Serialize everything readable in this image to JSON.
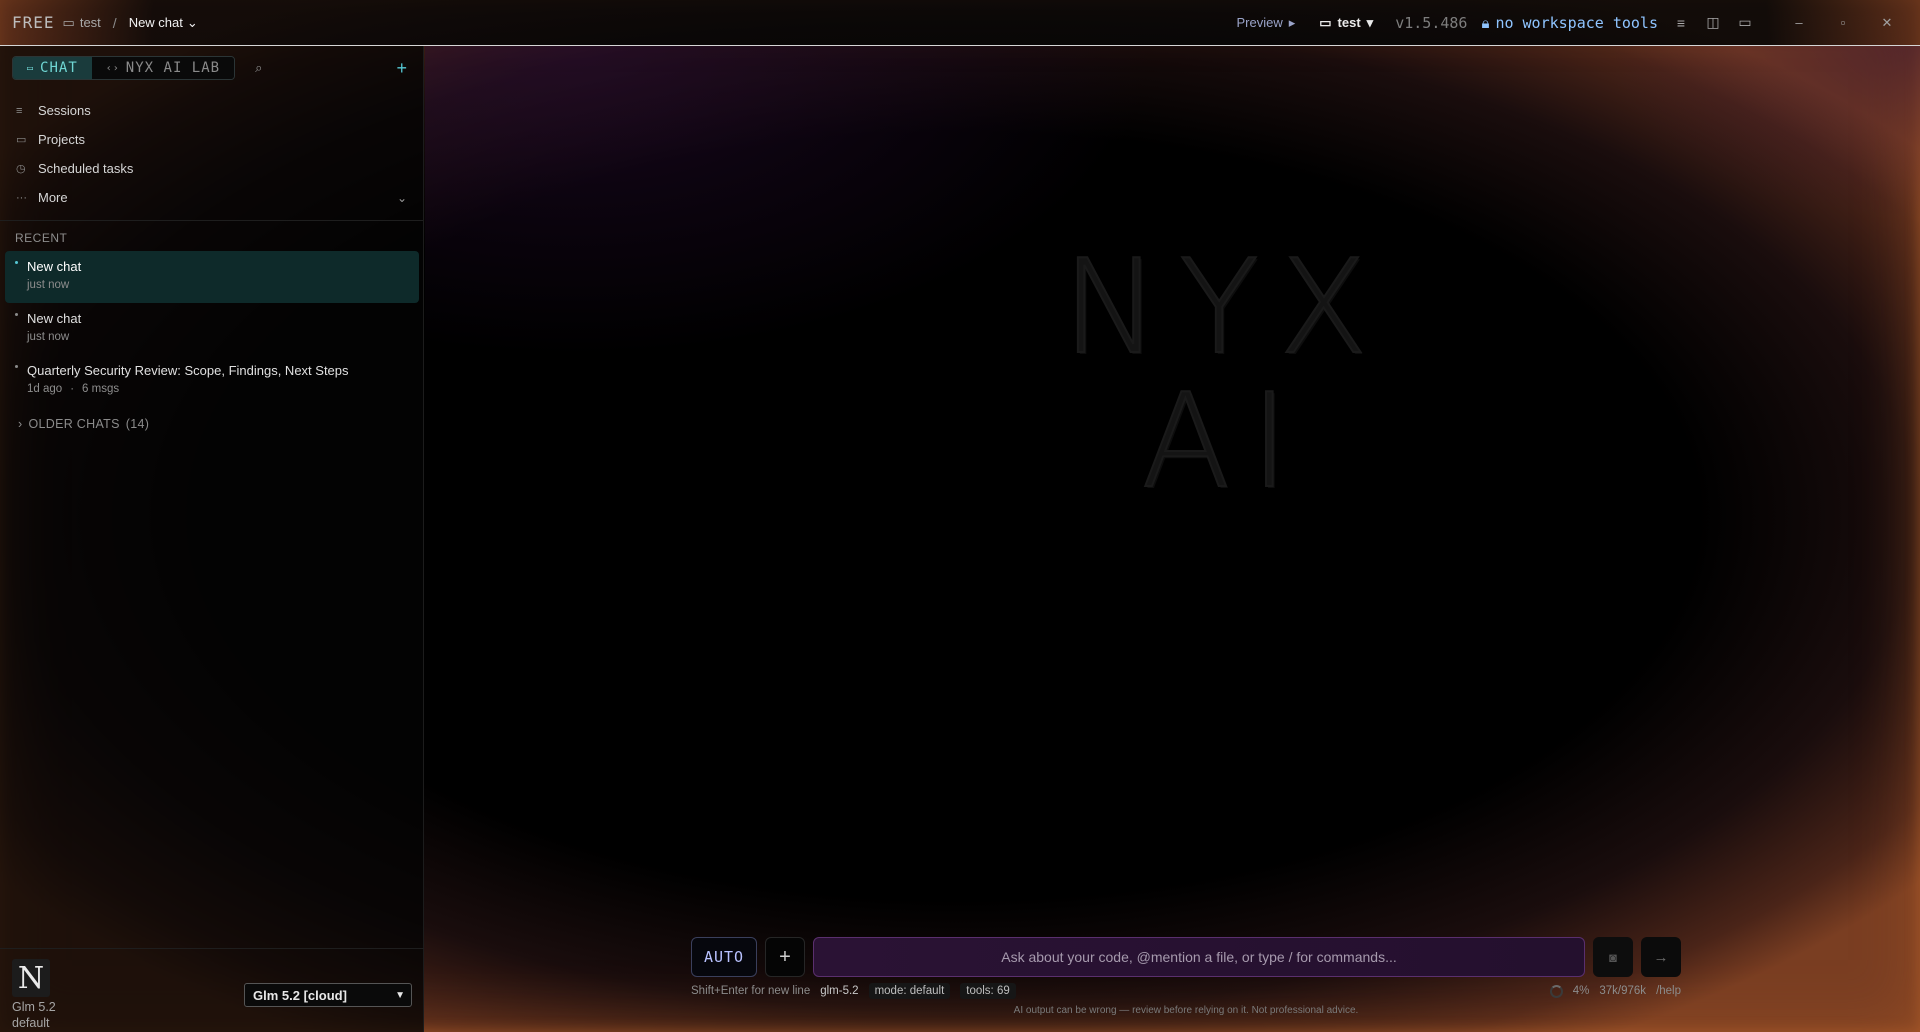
{
  "titlebar": {
    "plan": "FREE",
    "workspace": "test",
    "current_chat": "New chat",
    "preview_label": "Preview",
    "workspace_select": "test",
    "version": "v1.5.486",
    "tools_status": "no workspace tools"
  },
  "sidebar": {
    "tabs": [
      {
        "label": "CHAT",
        "active": true
      },
      {
        "label": "NYX AI LAB",
        "active": false
      }
    ],
    "nav": [
      {
        "label": "Sessions",
        "icon": "list-icon"
      },
      {
        "label": "Projects",
        "icon": "folder-icon"
      },
      {
        "label": "Scheduled tasks",
        "icon": "clock-icon"
      },
      {
        "label": "More",
        "icon": "ellipsis-icon"
      }
    ],
    "recent_heading": "RECENT",
    "recent": [
      {
        "title": "New chat",
        "time": "just now",
        "msgs": "",
        "active": true
      },
      {
        "title": "New chat",
        "time": "just now",
        "msgs": "",
        "active": false
      },
      {
        "title": "Quarterly Security Review: Scope, Findings, Next Steps",
        "time": "1d ago",
        "msgs": "6 msgs",
        "active": false
      }
    ],
    "older_label": "OLDER CHATS",
    "older_count": "(14)",
    "logo_letter": "N",
    "model_name": "Glm 5.2",
    "model_profile": "default",
    "model_select": "Glm 5.2 [cloud]"
  },
  "main": {
    "hero_line1": "NYX",
    "hero_line2": "AI",
    "mode_button": "AUTO",
    "input_placeholder": "Ask about your code, @mention a file, or type / for commands...",
    "hint": "Shift+Enter for new line",
    "model": "glm-5.2",
    "mode_chip": "mode: default",
    "tools_chip": "tools: 69",
    "context_percent": "4%",
    "context_tokens": "37k/976k",
    "help": "/help",
    "disclaimer": "AI output can be wrong — review before relying on it. Not professional advice."
  },
  "colors": {
    "accent_teal": "#56c7d4",
    "accent_blue": "#8fc4ff",
    "input_purple": "#2a1234"
  }
}
